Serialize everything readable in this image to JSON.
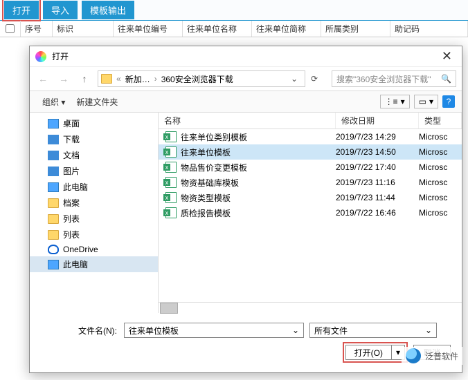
{
  "toolbar": {
    "open": "打开",
    "import": "导入",
    "template_out": "模板输出"
  },
  "grid": {
    "seq": "序号",
    "ident": "标识",
    "unit_no": "往来单位编号",
    "unit_name": "往来单位名称",
    "unit_short": "往来单位简称",
    "category": "所属类别",
    "mnemonic": "助记码"
  },
  "dialog": {
    "title": "打开",
    "close": "✕"
  },
  "nav": {
    "crumb1": "新加…",
    "crumb2": "360安全浏览器下载",
    "search_ph": "搜索\"360安全浏览器下载\""
  },
  "tools": {
    "organize": "组织 ▾",
    "newfolder": "新建文件夹",
    "view": "⋮≡",
    "detail": "▭"
  },
  "tree": [
    {
      "label": "桌面",
      "icon": "ic-monitor"
    },
    {
      "label": "下载",
      "icon": "ic-blue"
    },
    {
      "label": "文档",
      "icon": "ic-blue"
    },
    {
      "label": "图片",
      "icon": "ic-blue"
    },
    {
      "label": "此电脑",
      "icon": "ic-monitor"
    },
    {
      "label": "档案",
      "icon": "ic-folder"
    },
    {
      "label": "列表",
      "icon": "ic-folder"
    },
    {
      "label": "列表",
      "icon": "ic-folder"
    },
    {
      "label": "OneDrive",
      "icon": "ic-cloud"
    },
    {
      "label": "此电脑",
      "icon": "ic-monitor",
      "sel": true
    }
  ],
  "file_header": {
    "name": "名称",
    "date": "修改日期",
    "type": "类型"
  },
  "files": [
    {
      "name": "往来单位类别模板",
      "date": "2019/7/23 14:29",
      "type": "Microsc"
    },
    {
      "name": "往来单位模板",
      "date": "2019/7/23 14:50",
      "type": "Microsc",
      "sel": true
    },
    {
      "name": "物品售价变更模板",
      "date": "2019/7/22 17:40",
      "type": "Microsc"
    },
    {
      "name": "物资基础库模板",
      "date": "2019/7/23 11:16",
      "type": "Microsc"
    },
    {
      "name": "物资类型模板",
      "date": "2019/7/23 11:44",
      "type": "Microsc"
    },
    {
      "name": "质检报告模板",
      "date": "2019/7/22 16:46",
      "type": "Microsc"
    }
  ],
  "bottom": {
    "fn_label": "文件名(N):",
    "fn_value": "往来单位模板",
    "type_value": "所有文件",
    "open": "打开(O)",
    "cancel": "取消"
  },
  "watermark": "泛普软件"
}
